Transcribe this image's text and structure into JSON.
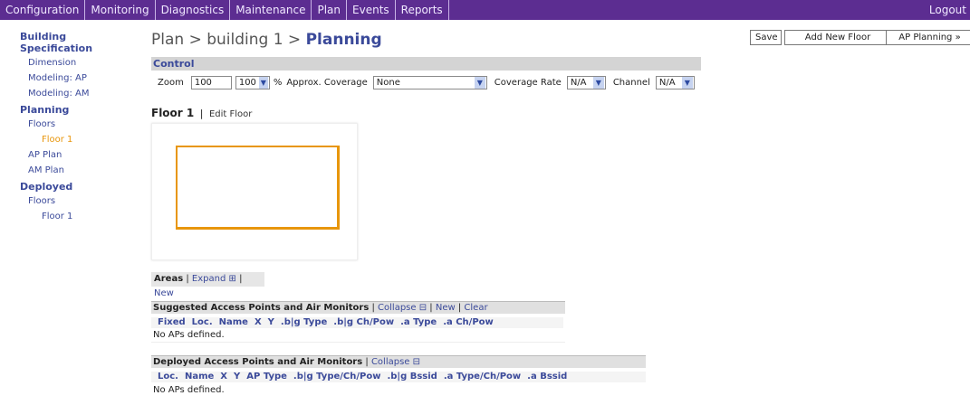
{
  "topnav": {
    "items": [
      "Configuration",
      "Monitoring",
      "Diagnostics",
      "Maintenance",
      "Plan",
      "Events",
      "Reports"
    ],
    "logout": "Logout"
  },
  "sidebar": {
    "building_spec": "Building Specification",
    "dimension": "Dimension",
    "modeling_ap": "Modeling: AP",
    "modeling_am": "Modeling: AM",
    "planning": "Planning",
    "floors": "Floors",
    "floor1_active": "Floor 1",
    "ap_plan": "AP Plan",
    "am_plan": "AM Plan",
    "deployed": "Deployed",
    "deployed_floors": "Floors",
    "deployed_floor1": "Floor 1"
  },
  "header": {
    "crumb_prefix": "Plan > building 1 > ",
    "crumb_current": "Planning"
  },
  "buttons": {
    "save": "Save",
    "add_floor": "Add New Floor",
    "ap_planning": "AP Planning »"
  },
  "control": {
    "title": "Control",
    "zoom_label": "Zoom",
    "zoom_value": "100",
    "zoom_select": "100",
    "percent": "%",
    "coverage_label": "Approx. Coverage",
    "coverage_value": "None",
    "rate_label": "Coverage Rate",
    "rate_value": "N/A",
    "channel_label": "Channel",
    "channel_value": "N/A"
  },
  "floor": {
    "name": "Floor 1",
    "sep": "|",
    "edit": "Edit Floor"
  },
  "areas": {
    "label": "Areas",
    "sep1": "|",
    "expand": "Expand ⊞",
    "sep2": "|",
    "new": "New"
  },
  "suggested": {
    "title": "Suggested Access Points and Air Monitors",
    "sep1": "|",
    "collapse": "Collapse ⊟",
    "sep2": "|",
    "new": "New",
    "sep3": "|",
    "clear": "Clear",
    "columns": [
      "Fixed",
      "Loc.",
      "Name",
      "X",
      "Y",
      ".b|g Type",
      ".b|g Ch/Pow",
      ".a Type",
      ".a Ch/Pow"
    ],
    "empty": "No APs defined."
  },
  "deployed": {
    "title": "Deployed Access Points and Air Monitors",
    "sep1": "|",
    "collapse": "Collapse ⊟",
    "columns": [
      "Loc.",
      "Name",
      "X",
      "Y",
      "AP Type",
      ".b|g Type/Ch/Pow",
      ".b|g Bssid",
      ".a Type/Ch/Pow",
      ".a Bssid"
    ],
    "empty": "No APs defined."
  }
}
